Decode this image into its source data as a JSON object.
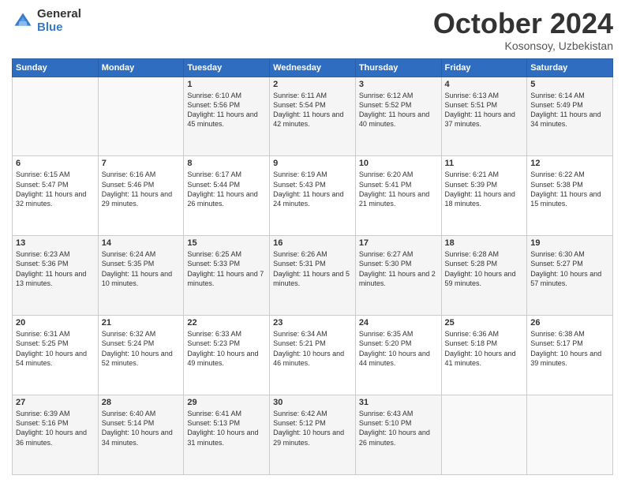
{
  "header": {
    "logo": {
      "general": "General",
      "blue": "Blue"
    },
    "title": "October 2024",
    "subtitle": "Kosonsoy, Uzbekistan"
  },
  "weekdays": [
    "Sunday",
    "Monday",
    "Tuesday",
    "Wednesday",
    "Thursday",
    "Friday",
    "Saturday"
  ],
  "weeks": [
    [
      {
        "day": "",
        "sunrise": "",
        "sunset": "",
        "daylight": ""
      },
      {
        "day": "",
        "sunrise": "",
        "sunset": "",
        "daylight": ""
      },
      {
        "day": "1",
        "sunrise": "Sunrise: 6:10 AM",
        "sunset": "Sunset: 5:56 PM",
        "daylight": "Daylight: 11 hours and 45 minutes."
      },
      {
        "day": "2",
        "sunrise": "Sunrise: 6:11 AM",
        "sunset": "Sunset: 5:54 PM",
        "daylight": "Daylight: 11 hours and 42 minutes."
      },
      {
        "day": "3",
        "sunrise": "Sunrise: 6:12 AM",
        "sunset": "Sunset: 5:52 PM",
        "daylight": "Daylight: 11 hours and 40 minutes."
      },
      {
        "day": "4",
        "sunrise": "Sunrise: 6:13 AM",
        "sunset": "Sunset: 5:51 PM",
        "daylight": "Daylight: 11 hours and 37 minutes."
      },
      {
        "day": "5",
        "sunrise": "Sunrise: 6:14 AM",
        "sunset": "Sunset: 5:49 PM",
        "daylight": "Daylight: 11 hours and 34 minutes."
      }
    ],
    [
      {
        "day": "6",
        "sunrise": "Sunrise: 6:15 AM",
        "sunset": "Sunset: 5:47 PM",
        "daylight": "Daylight: 11 hours and 32 minutes."
      },
      {
        "day": "7",
        "sunrise": "Sunrise: 6:16 AM",
        "sunset": "Sunset: 5:46 PM",
        "daylight": "Daylight: 11 hours and 29 minutes."
      },
      {
        "day": "8",
        "sunrise": "Sunrise: 6:17 AM",
        "sunset": "Sunset: 5:44 PM",
        "daylight": "Daylight: 11 hours and 26 minutes."
      },
      {
        "day": "9",
        "sunrise": "Sunrise: 6:19 AM",
        "sunset": "Sunset: 5:43 PM",
        "daylight": "Daylight: 11 hours and 24 minutes."
      },
      {
        "day": "10",
        "sunrise": "Sunrise: 6:20 AM",
        "sunset": "Sunset: 5:41 PM",
        "daylight": "Daylight: 11 hours and 21 minutes."
      },
      {
        "day": "11",
        "sunrise": "Sunrise: 6:21 AM",
        "sunset": "Sunset: 5:39 PM",
        "daylight": "Daylight: 11 hours and 18 minutes."
      },
      {
        "day": "12",
        "sunrise": "Sunrise: 6:22 AM",
        "sunset": "Sunset: 5:38 PM",
        "daylight": "Daylight: 11 hours and 15 minutes."
      }
    ],
    [
      {
        "day": "13",
        "sunrise": "Sunrise: 6:23 AM",
        "sunset": "Sunset: 5:36 PM",
        "daylight": "Daylight: 11 hours and 13 minutes."
      },
      {
        "day": "14",
        "sunrise": "Sunrise: 6:24 AM",
        "sunset": "Sunset: 5:35 PM",
        "daylight": "Daylight: 11 hours and 10 minutes."
      },
      {
        "day": "15",
        "sunrise": "Sunrise: 6:25 AM",
        "sunset": "Sunset: 5:33 PM",
        "daylight": "Daylight: 11 hours and 7 minutes."
      },
      {
        "day": "16",
        "sunrise": "Sunrise: 6:26 AM",
        "sunset": "Sunset: 5:31 PM",
        "daylight": "Daylight: 11 hours and 5 minutes."
      },
      {
        "day": "17",
        "sunrise": "Sunrise: 6:27 AM",
        "sunset": "Sunset: 5:30 PM",
        "daylight": "Daylight: 11 hours and 2 minutes."
      },
      {
        "day": "18",
        "sunrise": "Sunrise: 6:28 AM",
        "sunset": "Sunset: 5:28 PM",
        "daylight": "Daylight: 10 hours and 59 minutes."
      },
      {
        "day": "19",
        "sunrise": "Sunrise: 6:30 AM",
        "sunset": "Sunset: 5:27 PM",
        "daylight": "Daylight: 10 hours and 57 minutes."
      }
    ],
    [
      {
        "day": "20",
        "sunrise": "Sunrise: 6:31 AM",
        "sunset": "Sunset: 5:25 PM",
        "daylight": "Daylight: 10 hours and 54 minutes."
      },
      {
        "day": "21",
        "sunrise": "Sunrise: 6:32 AM",
        "sunset": "Sunset: 5:24 PM",
        "daylight": "Daylight: 10 hours and 52 minutes."
      },
      {
        "day": "22",
        "sunrise": "Sunrise: 6:33 AM",
        "sunset": "Sunset: 5:23 PM",
        "daylight": "Daylight: 10 hours and 49 minutes."
      },
      {
        "day": "23",
        "sunrise": "Sunrise: 6:34 AM",
        "sunset": "Sunset: 5:21 PM",
        "daylight": "Daylight: 10 hours and 46 minutes."
      },
      {
        "day": "24",
        "sunrise": "Sunrise: 6:35 AM",
        "sunset": "Sunset: 5:20 PM",
        "daylight": "Daylight: 10 hours and 44 minutes."
      },
      {
        "day": "25",
        "sunrise": "Sunrise: 6:36 AM",
        "sunset": "Sunset: 5:18 PM",
        "daylight": "Daylight: 10 hours and 41 minutes."
      },
      {
        "day": "26",
        "sunrise": "Sunrise: 6:38 AM",
        "sunset": "Sunset: 5:17 PM",
        "daylight": "Daylight: 10 hours and 39 minutes."
      }
    ],
    [
      {
        "day": "27",
        "sunrise": "Sunrise: 6:39 AM",
        "sunset": "Sunset: 5:16 PM",
        "daylight": "Daylight: 10 hours and 36 minutes."
      },
      {
        "day": "28",
        "sunrise": "Sunrise: 6:40 AM",
        "sunset": "Sunset: 5:14 PM",
        "daylight": "Daylight: 10 hours and 34 minutes."
      },
      {
        "day": "29",
        "sunrise": "Sunrise: 6:41 AM",
        "sunset": "Sunset: 5:13 PM",
        "daylight": "Daylight: 10 hours and 31 minutes."
      },
      {
        "day": "30",
        "sunrise": "Sunrise: 6:42 AM",
        "sunset": "Sunset: 5:12 PM",
        "daylight": "Daylight: 10 hours and 29 minutes."
      },
      {
        "day": "31",
        "sunrise": "Sunrise: 6:43 AM",
        "sunset": "Sunset: 5:10 PM",
        "daylight": "Daylight: 10 hours and 26 minutes."
      },
      {
        "day": "",
        "sunrise": "",
        "sunset": "",
        "daylight": ""
      },
      {
        "day": "",
        "sunrise": "",
        "sunset": "",
        "daylight": ""
      }
    ]
  ]
}
